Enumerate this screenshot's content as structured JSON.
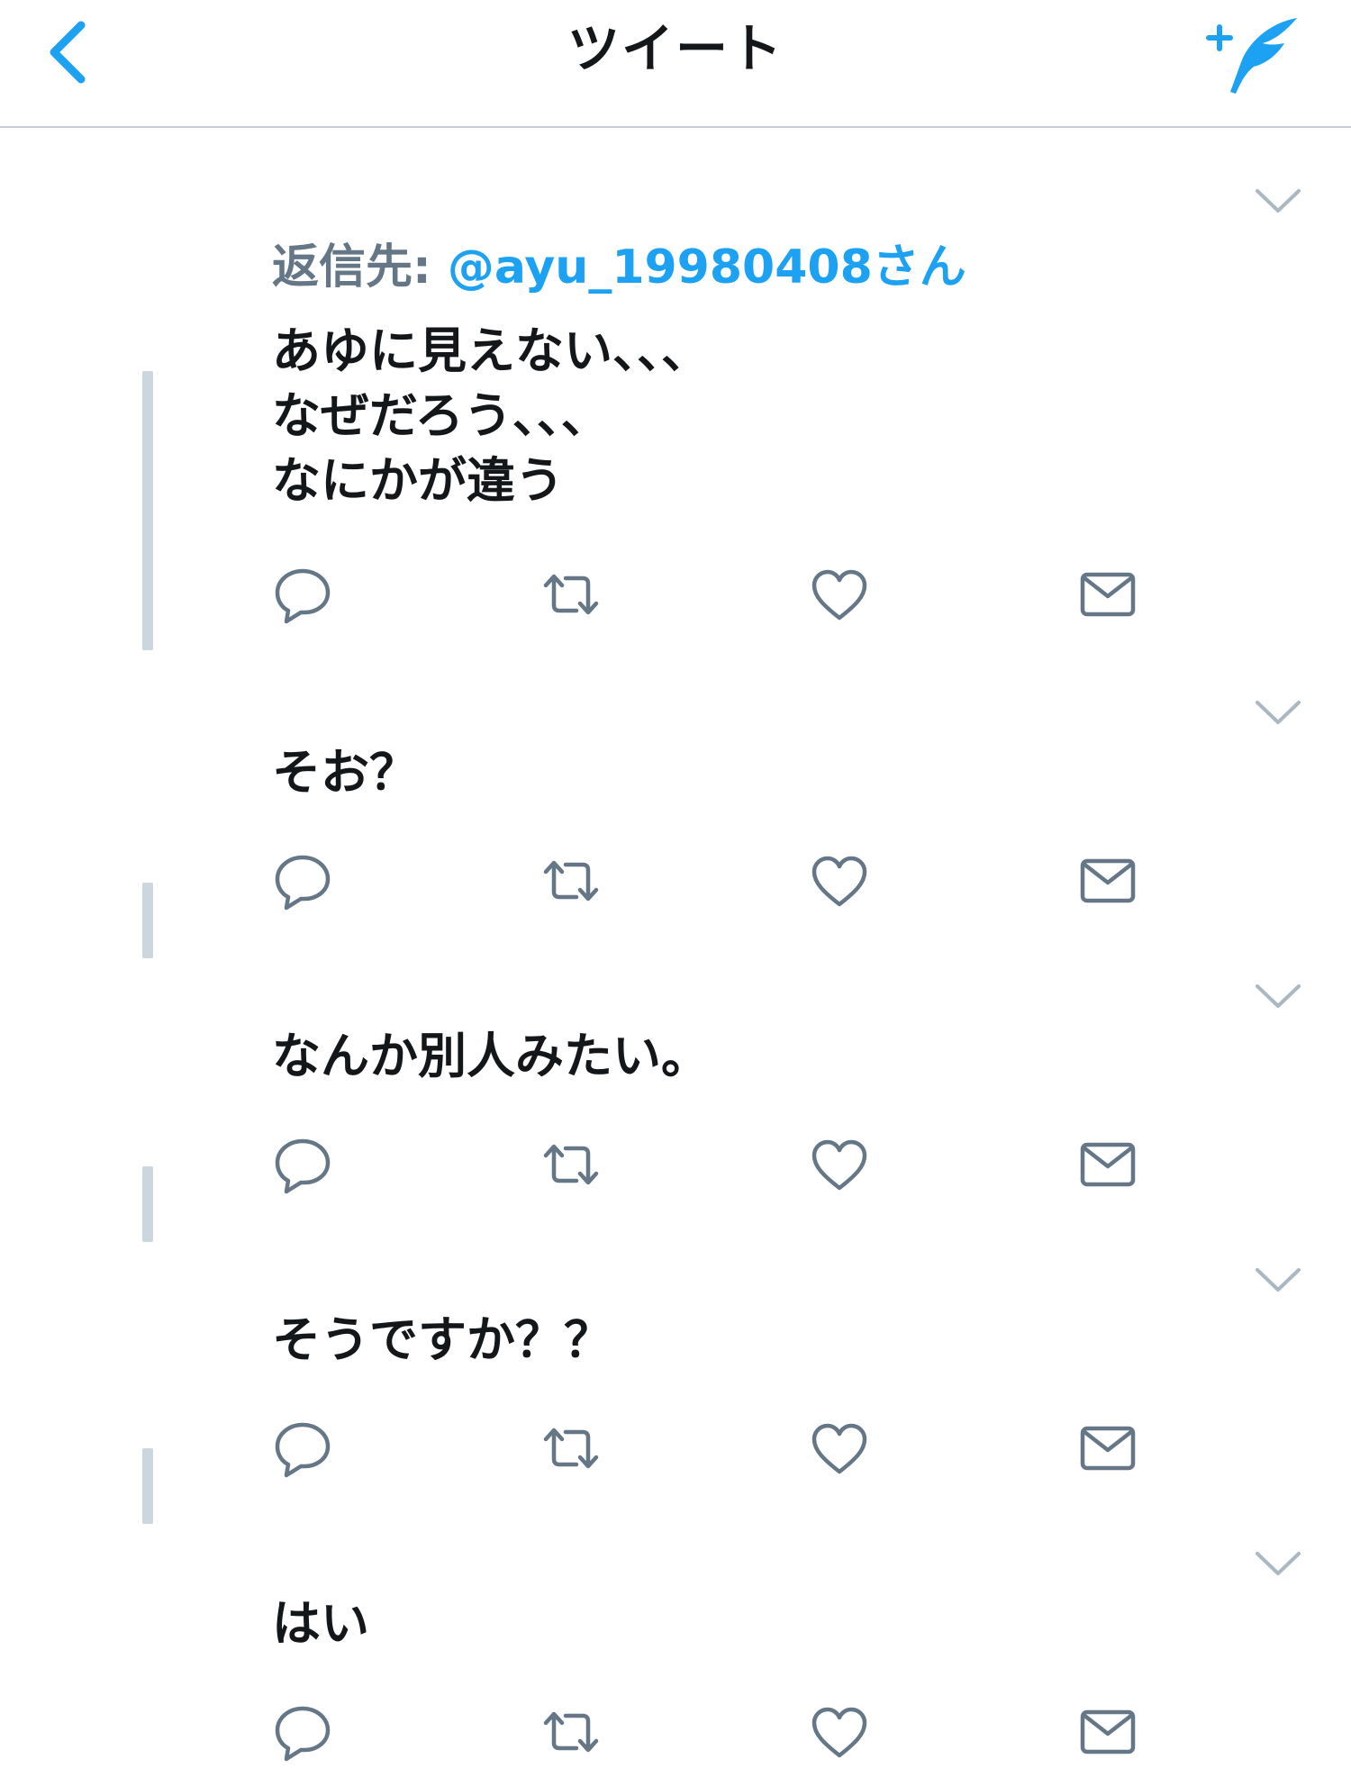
{
  "header": {
    "title": "ツイート",
    "back_icon": "chevron-left-icon",
    "compose_icon": "compose-tweet-icon",
    "accent_color": "#1da1f2"
  },
  "colors": {
    "text": "#14171a",
    "secondary": "#657786",
    "icon": "#657786",
    "thread_line": "#ccd6dd",
    "divider": "#c7cdd4"
  },
  "tweets": [
    {
      "reply_prefix": "返信先: ",
      "reply_handle": "@ayu_19980408さん",
      "text": "あゆに見えない、、、\nなぜだろう、、、\nなにかが違う"
    },
    {
      "text": "そお？"
    },
    {
      "text": "なんか別人みたい。"
    },
    {
      "text": "そうですか？？"
    },
    {
      "text": "はい"
    }
  ],
  "action_icons": [
    "reply-icon",
    "retweet-icon",
    "like-icon",
    "direct-message-icon"
  ]
}
